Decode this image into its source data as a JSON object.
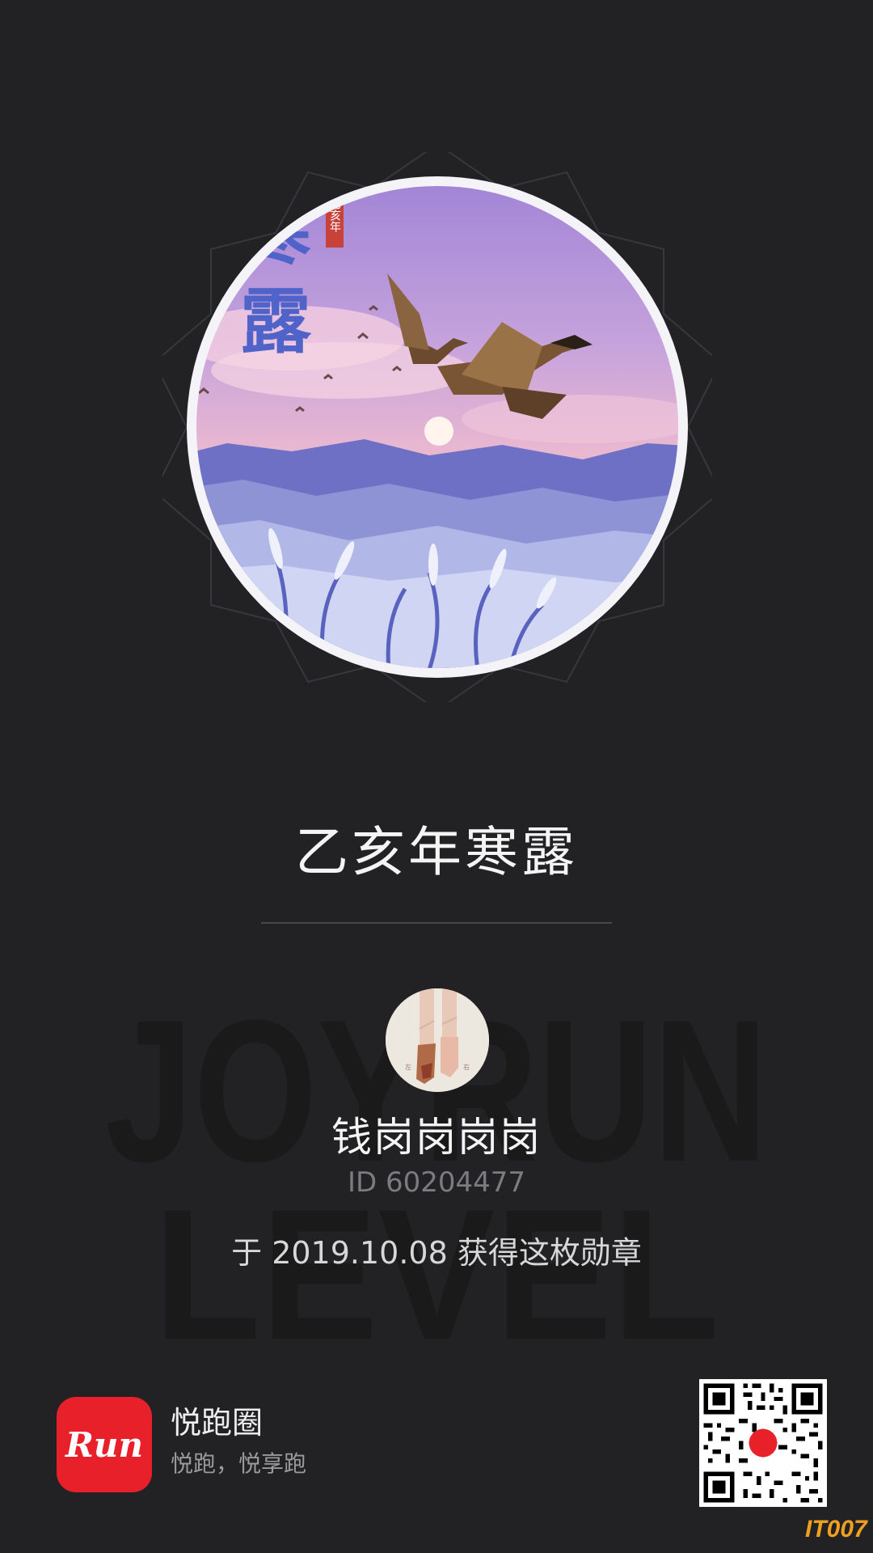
{
  "badge": {
    "title_chars": [
      "寒",
      "露"
    ],
    "seal": "乙亥年",
    "icon": "geese-over-mountains-illustration"
  },
  "medal": {
    "title": "乙亥年寒露"
  },
  "watermark": {
    "line1": "JOYRUN",
    "line2": "LEVEL"
  },
  "user": {
    "avatar": "ballet-shoes-avatar",
    "name": "钱岗岗岗岗",
    "id": "ID 60204477",
    "earned": "于 2019.10.08 获得这枚勋章"
  },
  "footer": {
    "app_icon_label": "Run",
    "app_name": "悦跑圈",
    "slogan": "悦跑，悦享跑",
    "qr_icon": "qr-code-icon",
    "site_mark": "IT007"
  },
  "colors": {
    "background": "#222224",
    "app_red": "#e8202a",
    "badge_title_blue": "#4f63c9",
    "site_mark_orange": "#f0a020"
  }
}
